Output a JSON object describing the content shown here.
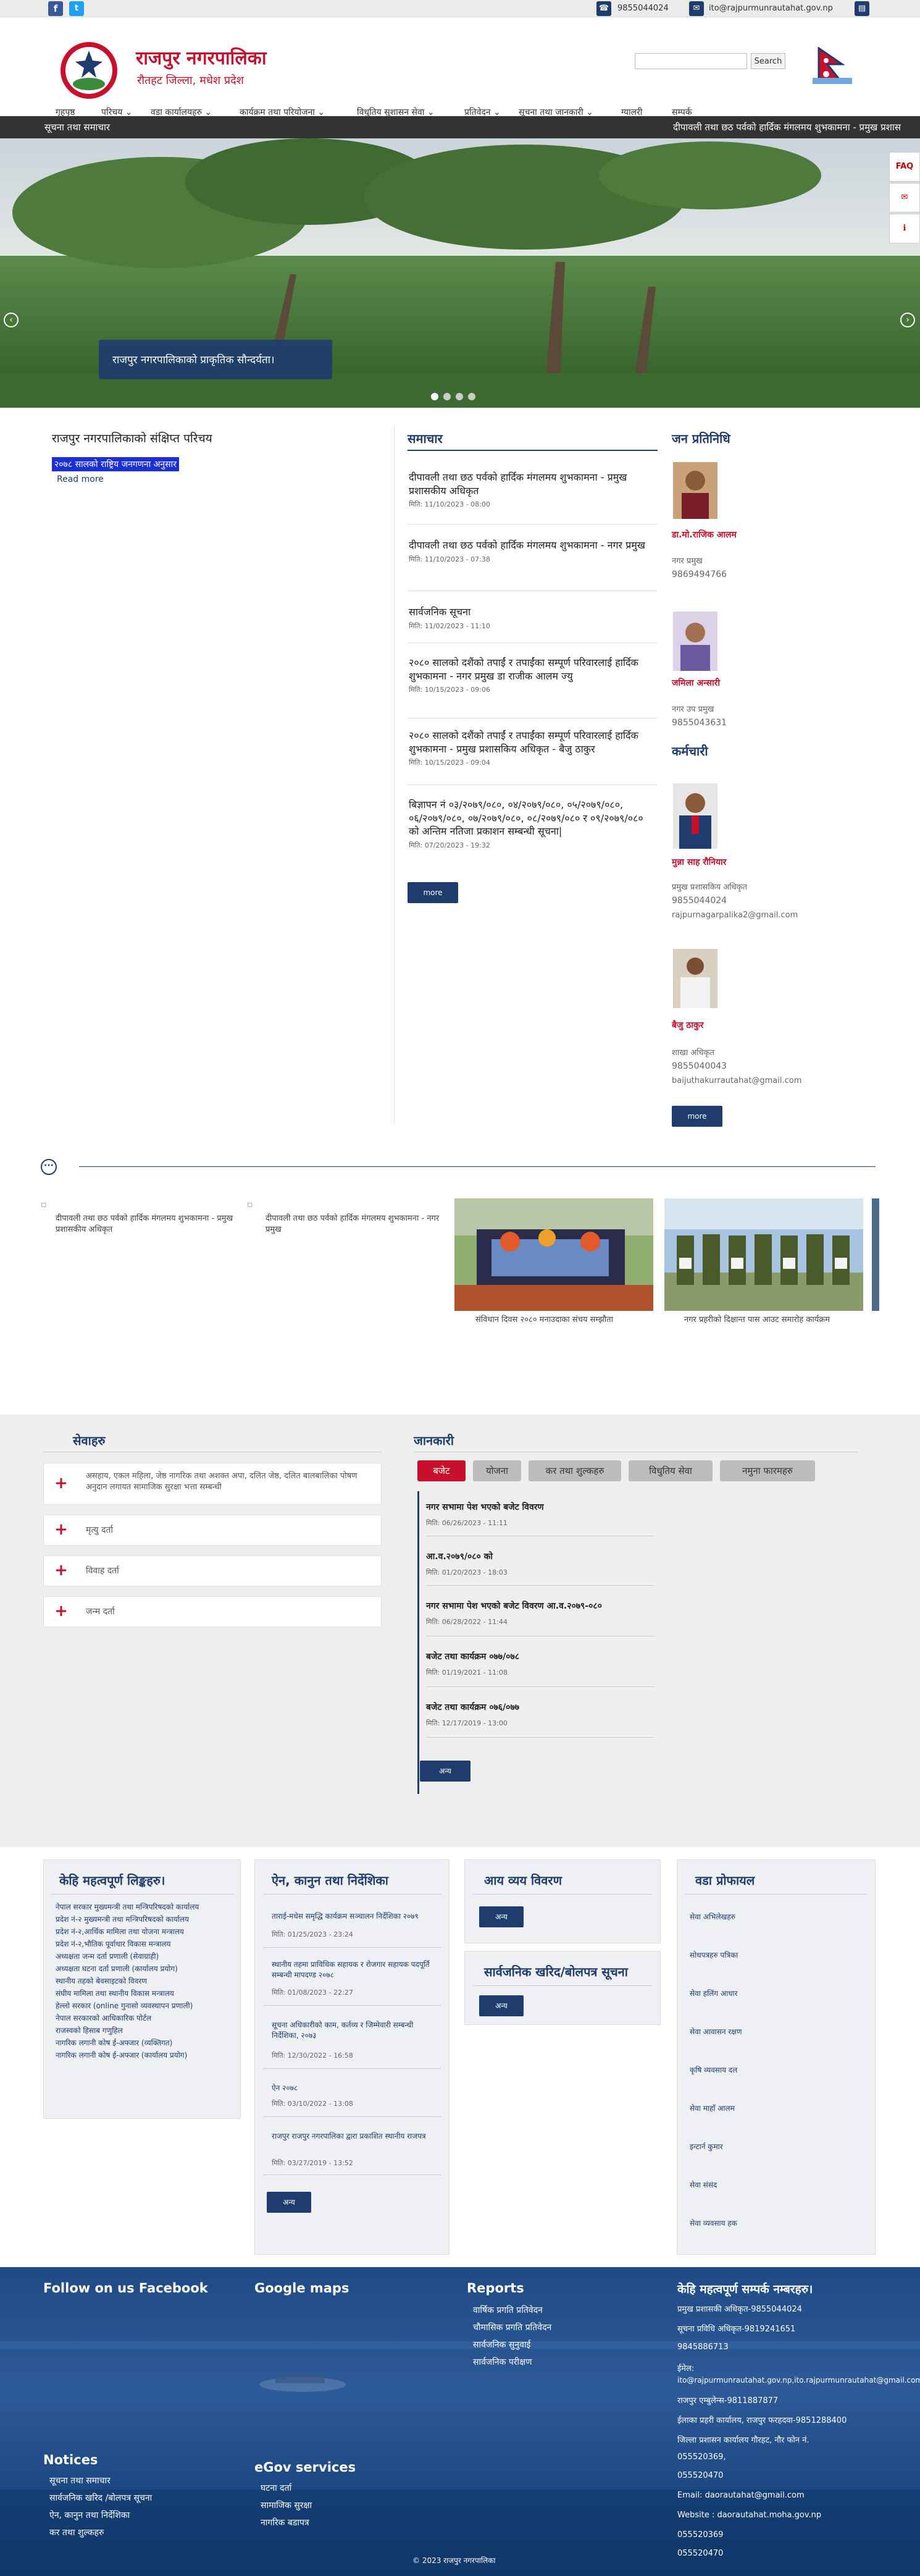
{
  "topbar": {
    "phone": "9855044024",
    "email": "ito@rajpurmunrautahat.gov.np"
  },
  "header": {
    "title": "राजपुर नगरपालिका",
    "subtitle": "रौतहट जिल्ला, मधेश प्रदेश",
    "search_placeholder": "",
    "search_button": "Search",
    "flag_caption": "Nepal Flag"
  },
  "nav": [
    {
      "label": "गृहपृष्ठ"
    },
    {
      "label": "परिचय ⌄"
    },
    {
      "label": "वडा कार्यालयहरु ⌄"
    },
    {
      "label": "कार्यक्रम तथा परियोजना ⌄"
    },
    {
      "label": "विधुतिय सुशासन सेवा ⌄"
    },
    {
      "label": "प्रतिवेदन ⌄"
    },
    {
      "label": "सूचना तथा जानकारी ⌄"
    },
    {
      "label": "ग्यालरी"
    },
    {
      "label": "सम्पर्क"
    }
  ],
  "ticker": {
    "label": "सूचना तथा समाचार",
    "text": "दीपावली तथा छठ पर्वको हार्दिक मंगलमय शुभकामना - प्रमुख प्रशास"
  },
  "slider": {
    "caption": "राजपुर नगरपालिकाको प्राकृतिक सौन्दर्यता।"
  },
  "side_buttons": {
    "faq": "FAQ",
    "chat": "",
    "info": ""
  },
  "intro": {
    "heading": "राजपुर नगरपालिकाको संक्षिप्त परिचय",
    "highlight": "२०७८ सालको राष्ट्रिय जनगणना अनुसार",
    "read_more": "Read more"
  },
  "news": {
    "heading": "समाचार",
    "items": [
      {
        "title": "दीपावली तथा छठ पर्वको हार्दिक मंगलमय शुभकामना - प्रमुख प्रशासकीय अधिकृत",
        "date": "मिति: 11/10/2023 - 08:00"
      },
      {
        "title": "दीपावली तथा छठ पर्वको हार्दिक मंगलमय शुभकामना - नगर प्रमुख",
        "date": "मिति: 11/10/2023 - 07:38"
      },
      {
        "title": "सार्वजनिक सूचना",
        "date": "मिति: 11/02/2023 - 11:10"
      },
      {
        "title": "२०८० सालको दशैंको तपाईं र तपाईंका सम्पूर्ण परिवारलाई हार्दिक शुभकामना - नगर प्रमुख डा राजीक आलम ज्यु",
        "date": "मिति: 10/15/2023 - 09:06"
      },
      {
        "title": "२०८० सालको दशैंको तपाईं र तपाईंका सम्पूर्ण परिवारलाई हार्दिक शुभकामना - प्रमुख प्रशासकिय अधिकृत - बैजु ठाकुर",
        "date": "मिति: 10/15/2023 - 09:04"
      },
      {
        "title": "बिज्ञापन नं ०३/२०७९/०८०, ०४/२०७९/०८०, ०५/२०७९/०८०, ०६/२०७९/०८०, ०७/२०७९/०८०, ०८/२०७९/०८० र ०९/२०७९/०८० को अन्तिम नतिजा प्रकाशन सम्बन्धी सूचना|",
        "date": "मिति: 07/20/2023 - 19:32"
      }
    ],
    "more": "more"
  },
  "reps": {
    "heading": "जन प्रतिनिधि",
    "people": [
      {
        "name": "डा.मो.राजिक आलम",
        "role": "नगर प्रमुख",
        "phone": "9869494766"
      },
      {
        "name": "जमिला अन्सारी",
        "role": "नगर उप प्रमुख",
        "phone": "9855043631"
      }
    ],
    "staff_heading": "कर्मचारी",
    "staff": [
      {
        "name": "मुन्ना साह रौनियार",
        "role": "प्रमुख प्रशासकिय अधिकृत",
        "phone": "9855044024",
        "email": "rajpurnagarpalika2@gmail.com"
      },
      {
        "name": "बैजु ठाकुर",
        "role": "शाखा अधिकृत",
        "phone": "9855040043",
        "email": "baijuthakurrautahat@gmail.com"
      }
    ],
    "more": "more"
  },
  "gallery": {
    "items": [
      {
        "caption": "दीपावली तथा छठ पर्वको हार्दिक मंगलमय शुभकामना - प्रमुख प्रशासकीय अधिकृत"
      },
      {
        "caption": "दीपावली तथा छठ पर्वको हार्दिक मंगलमय शुभकामना - नगर प्रमुख"
      },
      {
        "caption": "संविधान दिवस २०८० मनाउदाका संचय सम्झौता"
      },
      {
        "caption": "नगर प्रहरीको दिक्षान्त पास आउट समारोह कार्यक्रम"
      }
    ]
  },
  "services": {
    "heading": "सेवाहरु",
    "items": [
      {
        "label": "असहाय, एकल महिला, जेष्ठ नागरिक तथा अशक्त अपा, दलित जेष्ठ, दलित बालबालिका पोषण अनुदान लगायत सामाजिक सुरक्षा भत्ता सम्बन्धी"
      },
      {
        "label": "मृत्यु दर्ता"
      },
      {
        "label": "विवाह दर्ता"
      },
      {
        "label": "जन्म दर्ता"
      }
    ]
  },
  "info": {
    "heading": "जानकारी",
    "tabs": [
      {
        "label": "बजेट"
      },
      {
        "label": "योजना"
      },
      {
        "label": "कर तथा शुल्कहरु"
      },
      {
        "label": "विधुतिय सेवा"
      },
      {
        "label": "नमुना फारमहरु"
      }
    ],
    "budget": [
      {
        "title": "नगर सभामा पेश भएको बजेट विवरण",
        "date": "मिति: 06/26/2023 - 11:11"
      },
      {
        "title": "आ.व.२०७९/०८० को",
        "date": "मिति: 01/20/2023 - 18:03"
      },
      {
        "title": "नगर सभामा पेश भएको बजेट विवरण आ.व.२०७९-०८०",
        "date": "मिति: 06/28/2022 - 11:44"
      },
      {
        "title": "बजेट तथा कार्यक्रम ०७७/०७८",
        "date": "मिति: 01/19/2021 - 11:08"
      },
      {
        "title": "बजेट तथा कार्यक्रम ०७६/०७७",
        "date": "मिति: 12/17/2019 - 13:00"
      }
    ],
    "more": "अन्य"
  },
  "links": {
    "heading": "केहि महत्वपूर्ण लिङ्कहरु।",
    "items": [
      "नेपाल सरकार मुख्यमन्त्री तथा मन्त्रिपरिषदको कार्यालय",
      "प्रदेश नं-२ मुख्यमन्त्री तथा मन्त्रिपरिषदको कार्यालय",
      "प्रदेश नं-२,आर्थिक मामिला तथा योजना मन्त्रालय",
      "प्रदेश नं-२,भौतिक पूर्वाधार विकास मन्त्रालय",
      "अध्यक्षता जन्म दर्ता प्रणाली (सेवाग्राही)",
      "अध्यक्षता घटना दर्ता प्रणाली (कार्यालय प्रयोग)",
      "स्थानीय तहको बेवसाइटको विवरण",
      "संघीय मामिला तथा स्थानीय विकास मन्त्रालय",
      "हेल्लो सरकार (online गुनासो व्यवस्थापन प्रणाली)",
      "नेपाल सरकारको आधिकारिक पोर्टल",
      "राजस्वको हिसाब गणुहिल",
      "नागरिक लगानी कोष ई-अफ्जार (व्यक्तिगत)",
      "नागरिक लगानी कोष ई-अफ्जार (कार्यालय प्रयोग)"
    ]
  },
  "laws": {
    "heading": "ऐन, कानुन तथा निर्देशिका",
    "items": [
      {
        "title": "ताराई-मधेस समृद्धि कार्यक्रम सञ्चालन निर्देशिका २०७९",
        "date": "मिति: 01/25/2023 - 23:24"
      },
      {
        "title": "स्थानीय तहमा प्राविधिक सहायक र रोजगार सहायक पदपूर्ति सम्बन्धी मापदण्ड २०७८",
        "date": "मिति: 01/08/2023 - 22:27"
      },
      {
        "title": "सूचना अधिकारीको काम, कर्तव्य र जिम्मेवारी सम्बन्धी निर्देशिका, २०७३",
        "date": "मिति: 12/30/2022 - 16:58"
      },
      {
        "title": "ऐन २०७८",
        "date": "मिति: 03/10/2022 - 13:08"
      },
      {
        "title": "राजपुर राजपुर नगरपालिका द्वारा प्रकाशित स्थानीय राजपत्र",
        "date": "मिति: 03/27/2019 - 13:52"
      }
    ],
    "more": "अन्य"
  },
  "income": {
    "heading": "आय व्यय विवरण",
    "more": "अन्य",
    "purchase_heading": "सार्वजनिक खरिद/बोलपत्र सूचना",
    "purchase_more": "अन्य"
  },
  "ward_profile": {
    "heading": "वडा प्रोफायल",
    "items": [
      "सेवा अभिलेखहरु",
      "सोधपत्रहरु पत्रिका",
      "सेवा हलिंग आधार",
      "सेवा आवासन रक्षण",
      "कृषि व्यवसाय दल",
      "सेवा माहाँ आलम",
      "इन्टार्न कुमार",
      "सेवा संसंद",
      "सेवा व्यवसाय हक"
    ]
  },
  "footer": {
    "facebook": "Follow on us Facebook",
    "maps": "Google maps",
    "reports": {
      "heading": "Reports",
      "items": [
        "वार्षिक प्रगति प्रतिवेदन",
        "चौमासिक प्रगति प्रतिवेदन",
        "सार्वजनिक सुनुवाई",
        "सार्वजनिक परीक्षण"
      ]
    },
    "contacts": {
      "heading": "केहि महत्वपूर्ण सम्पर्क नम्बरहरु।",
      "items": [
        "प्रमुख प्रशासकी अधिकृत-9855044024",
        "सूचना प्रविधि अधिकृत-9819241651",
        "9845886713",
        "ईमेल:",
        "ito@rajpurmunrautahat.gov.np,ito.rajpurmunrautahat@gmail.com",
        "राजपुर एम्बुलेन्स-9811887877",
        "ईलाका प्रहरी कार्यालय, राजपुर फरहदवा-9851288400",
        "जिल्ला प्रशासन कार्यालय गौरहट, नौर फोन नं.",
        "055520369,",
        "055520470",
        "Email: daorautahat@gmail.com",
        "Website : daorautahat.moha.gov.np",
        "055520369",
        "055520470"
      ]
    },
    "notices": {
      "heading": "Notices",
      "items": [
        "सूचना तथा समाचार",
        "सार्वजनिक खरिद /बोलपत्र सूचना",
        "ऐन, कानुन तथा निर्देशिका",
        "कर तथा शुल्कहरु"
      ]
    },
    "egov": {
      "heading": "eGov services",
      "items": [
        "घटना दर्ता",
        "सामाजिक सुरक्षा",
        "नागरिक बडापत्र"
      ]
    },
    "copyright": "© 2023 राजपुर नगरपालिका"
  },
  "colors": {
    "primary": "#1e3d6e",
    "accent_red": "#c8102e",
    "ticker_bg": "#333333",
    "footer_bg": "#1f4a86"
  }
}
